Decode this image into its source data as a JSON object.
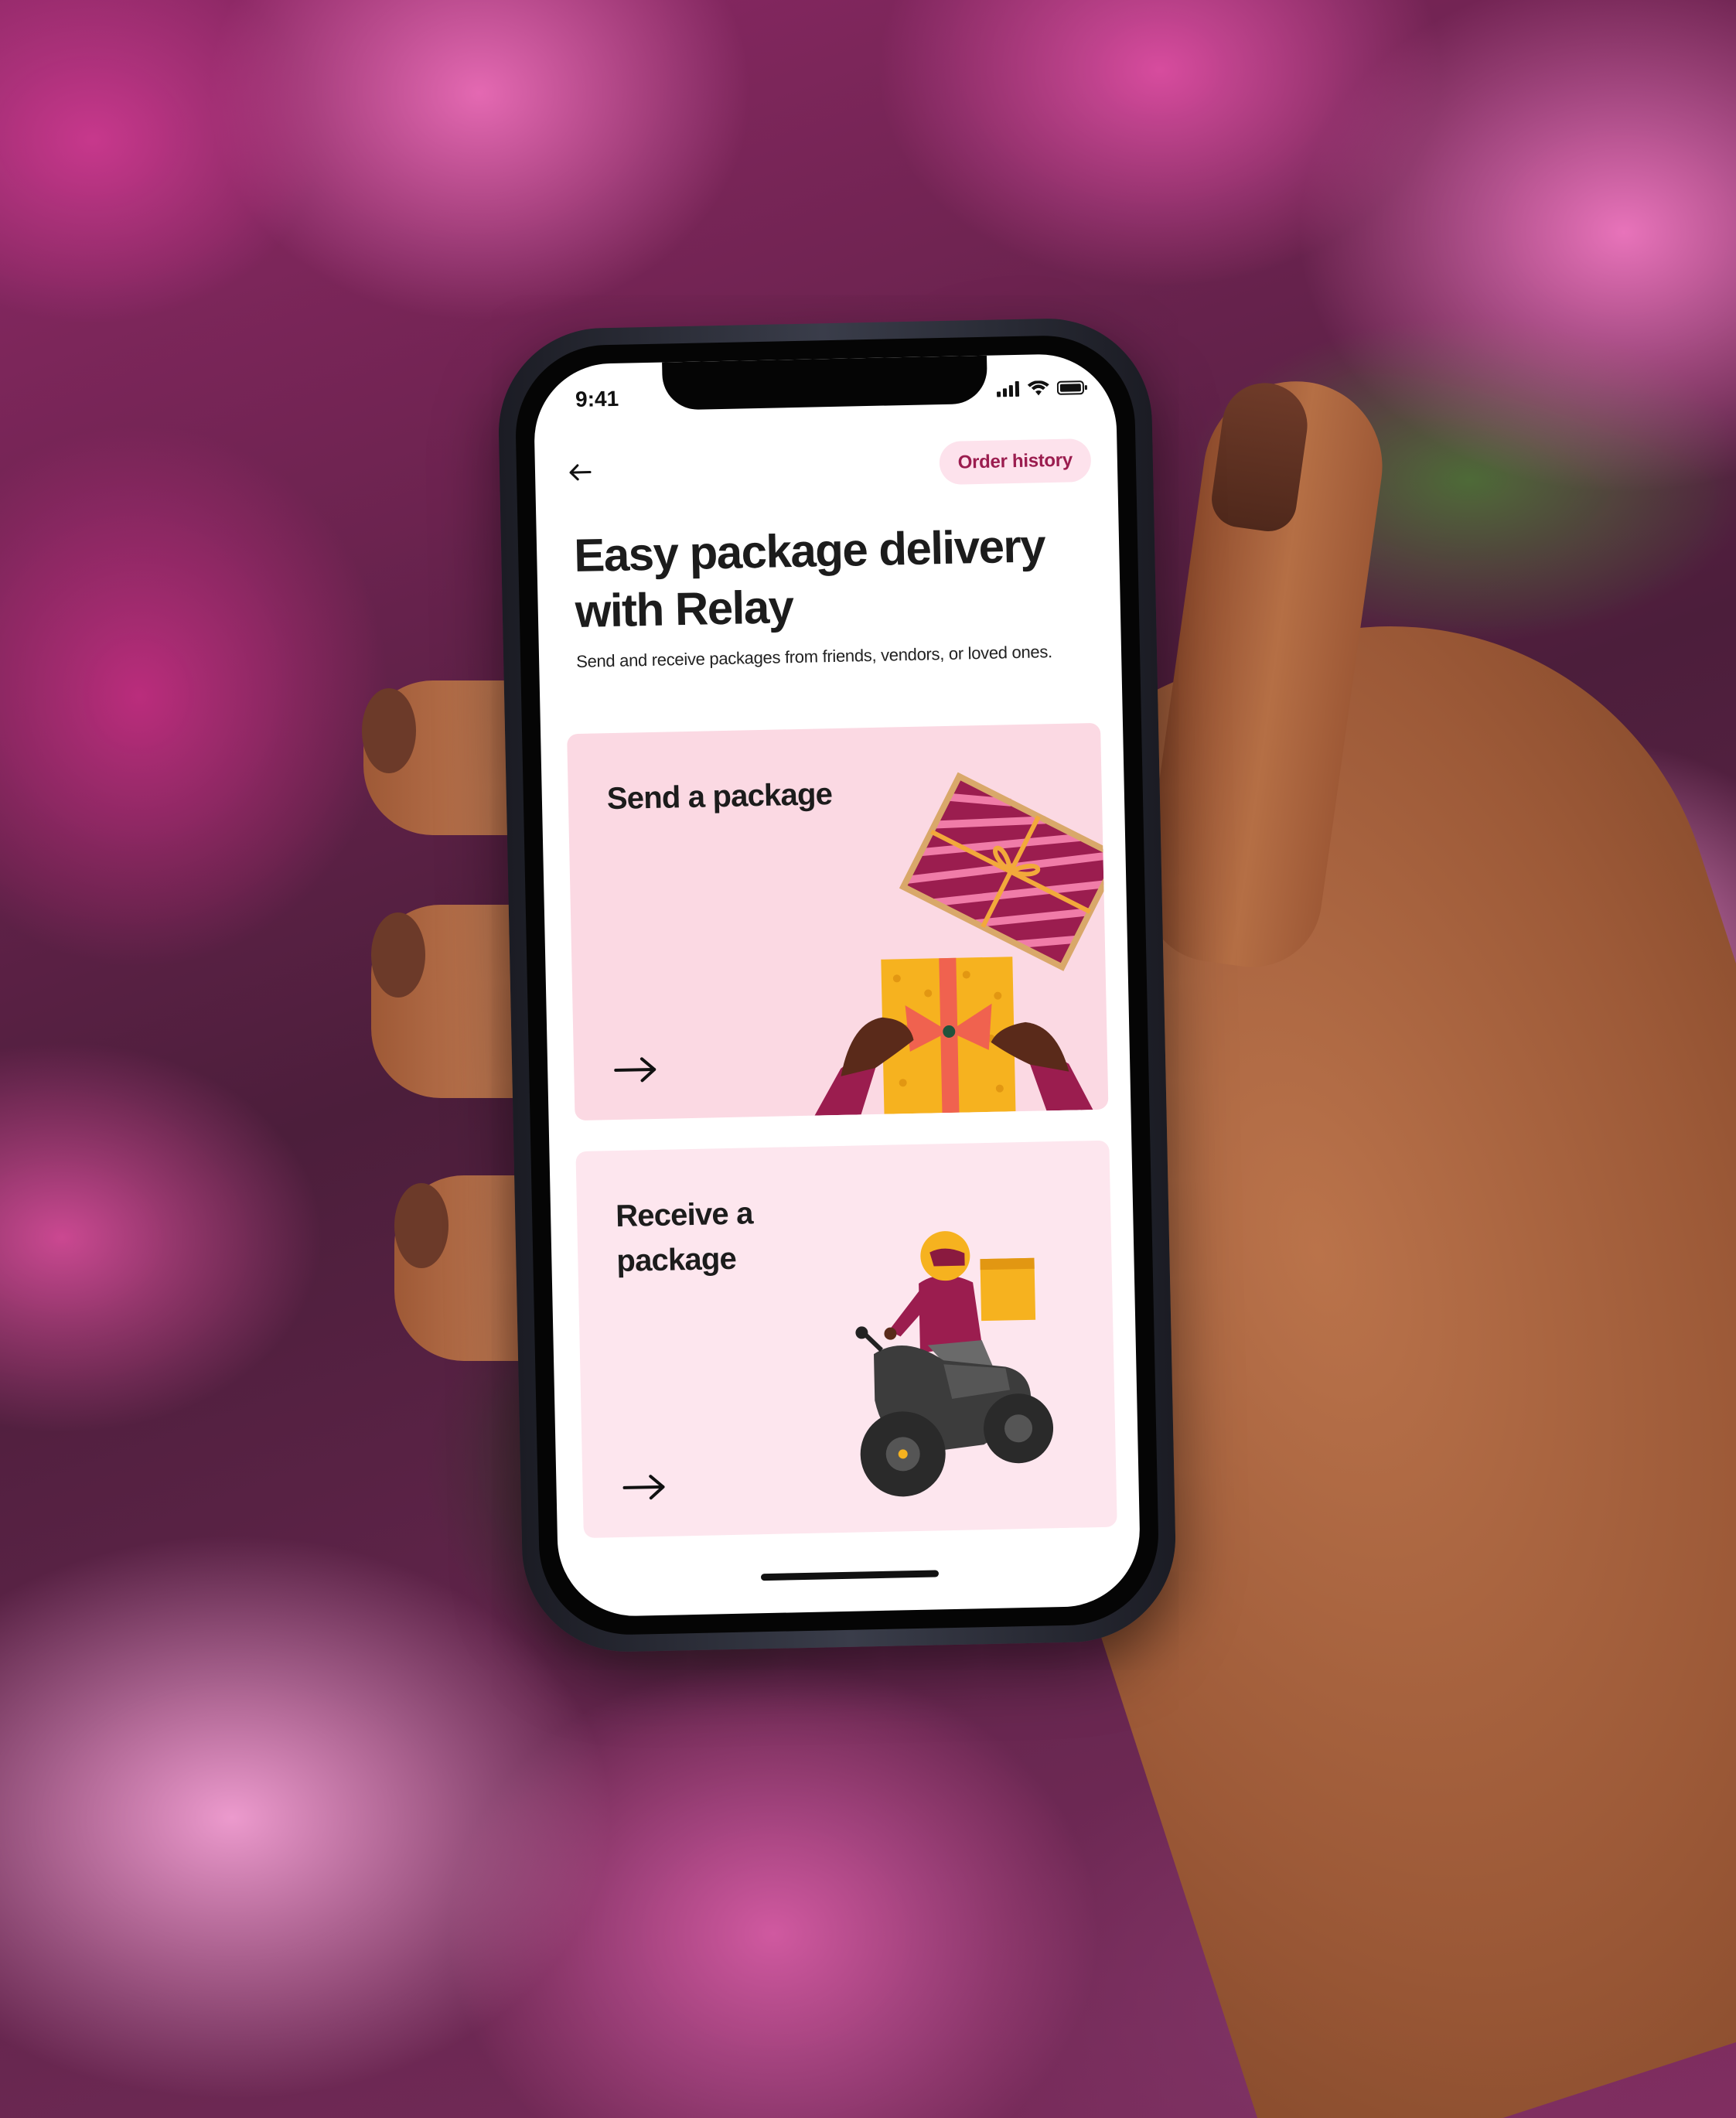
{
  "status_bar": {
    "time": "9:41"
  },
  "nav": {
    "back_icon": "arrow-left-icon",
    "order_history_label": "Order history"
  },
  "hero": {
    "title": "Easy package delivery with Relay",
    "subtitle": "Send and receive packages from friends, vendors, or loved ones."
  },
  "cards": [
    {
      "title": "Send a package",
      "arrow_icon": "arrow-right-icon",
      "illustration": "gift-box-illustration"
    },
    {
      "title": "Receive a package",
      "arrow_icon": "arrow-right-icon",
      "illustration": "delivery-motorbike-illustration"
    }
  ],
  "colors": {
    "accent": "#9b1d4f",
    "accent_bg": "#fde2ec",
    "send_card_bg": "#fbd9e3",
    "receive_card_bg": "#fde6ee",
    "text": "#1c1c1c"
  }
}
